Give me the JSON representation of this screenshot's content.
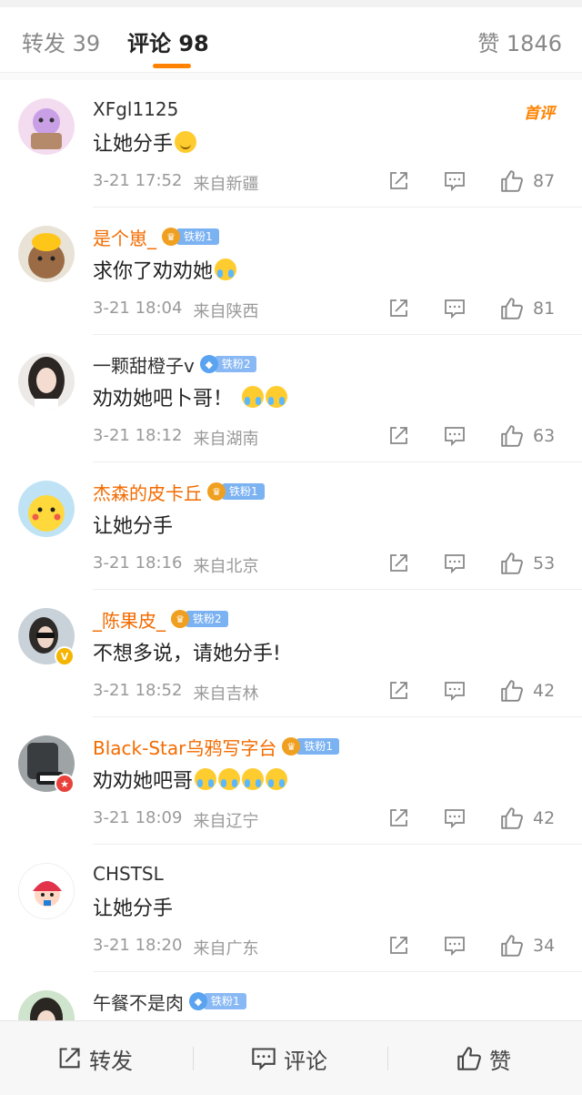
{
  "tabs": {
    "repost_label": "转发 39",
    "comment_label": "评论 98",
    "like_label": "赞 1846"
  },
  "accent_color": "#ff8200",
  "hot_tag": "首评",
  "comments": [
    {
      "username": "XFgl1125",
      "vip": false,
      "fan_badge": "",
      "content": "让她分手",
      "emojis": [
        "smile"
      ],
      "time": "3-21 17:52",
      "location": "来自新疆",
      "likes": "87"
    },
    {
      "username": "是个崽_",
      "vip": true,
      "fan_badge": "铁粉1",
      "content": "求你了劝劝她",
      "emojis": [
        "tear"
      ],
      "time": "3-21 18:04",
      "location": "来自陕西",
      "likes": "81"
    },
    {
      "username": "一颗甜橙子v",
      "vip": false,
      "fan_badge": "铁粉2",
      "content": "劝劝她吧卜哥！",
      "emojis": [
        "tear",
        "tear"
      ],
      "time": "3-21 18:12",
      "location": "来自湖南",
      "likes": "63"
    },
    {
      "username": "杰森的皮卡丘",
      "vip": true,
      "fan_badge": "铁粉1",
      "content": "让她分手",
      "emojis": [],
      "time": "3-21 18:16",
      "location": "来自北京",
      "likes": "53"
    },
    {
      "username": "_陈果皮_",
      "vip": true,
      "fan_badge": "铁粉2",
      "content": "不想多说，请她分手!",
      "emojis": [],
      "time": "3-21 18:52",
      "location": "来自吉林",
      "likes": "42"
    },
    {
      "username": "Black-Star乌鸦写字台",
      "vip": true,
      "fan_badge": "铁粉1",
      "content": "劝劝她吧哥",
      "emojis": [
        "tear",
        "tear",
        "tear",
        "tear"
      ],
      "time": "3-21 18:09",
      "location": "来自辽宁",
      "likes": "42"
    },
    {
      "username": "CHSTSL",
      "vip": false,
      "fan_badge": "",
      "content": "让她分手",
      "emojis": [],
      "time": "3-21 18:20",
      "location": "来自广东",
      "likes": "34"
    },
    {
      "username": "午餐不是肉",
      "vip": false,
      "fan_badge": "铁粉1",
      "content": "",
      "emojis": [],
      "time": "",
      "location": "",
      "likes": ""
    }
  ],
  "bottom_bar": {
    "share_label": "转发",
    "comment_label": "评论",
    "like_label": "赞"
  },
  "icons": {
    "share": "share-icon",
    "reply": "comment-icon",
    "like": "thumbs-up-icon"
  }
}
